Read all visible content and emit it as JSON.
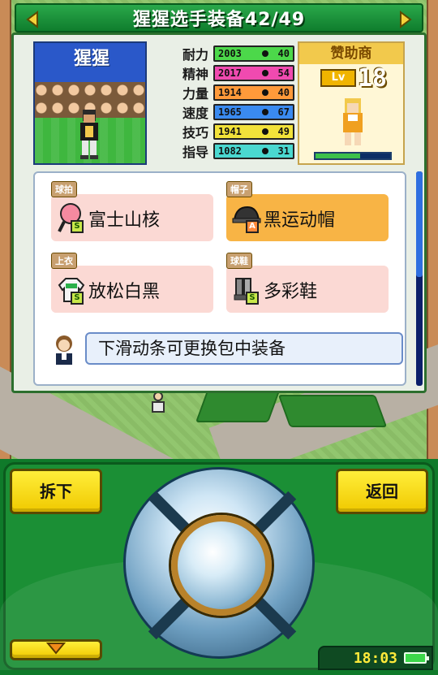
{
  "header": {
    "title": "猩猩选手装备42/49"
  },
  "player": {
    "name": "猩猩"
  },
  "stats": [
    {
      "label": "耐力",
      "value": "2003",
      "bonus": "40",
      "color": "#4cd84a"
    },
    {
      "label": "精神",
      "value": "2017",
      "bonus": "54",
      "color": "#f04ab0"
    },
    {
      "label": "力量",
      "value": "1914",
      "bonus": "40",
      "color": "#ff9a3a"
    },
    {
      "label": "速度",
      "value": "1965",
      "bonus": "67",
      "color": "#3a8af0"
    },
    {
      "label": "技巧",
      "value": "1941",
      "bonus": "49",
      "color": "#f2e23a"
    },
    {
      "label": "指导",
      "value": "1082",
      "bonus": "31",
      "color": "#4ad8d0"
    }
  ],
  "sponsor": {
    "title": "赞助商",
    "lv_label": "Lv",
    "level": "18",
    "progress": 0.6
  },
  "equipment": [
    {
      "slot": "球拍",
      "name": "富士山核",
      "grade": "S",
      "selected": false,
      "icon": "racket-icon"
    },
    {
      "slot": "帽子",
      "name": "黑运动帽",
      "grade": "A",
      "selected": true,
      "icon": "cap-icon"
    },
    {
      "slot": "上衣",
      "name": "放松白黑",
      "grade": "S",
      "selected": false,
      "icon": "shirt-icon"
    },
    {
      "slot": "球鞋",
      "name": "多彩鞋",
      "grade": "S",
      "selected": false,
      "icon": "shoe-icon"
    }
  ],
  "hint": {
    "text": "下滑动条可更换包中装备"
  },
  "controls": {
    "remove_label": "拆下",
    "back_label": "返回",
    "time": "18:03"
  }
}
